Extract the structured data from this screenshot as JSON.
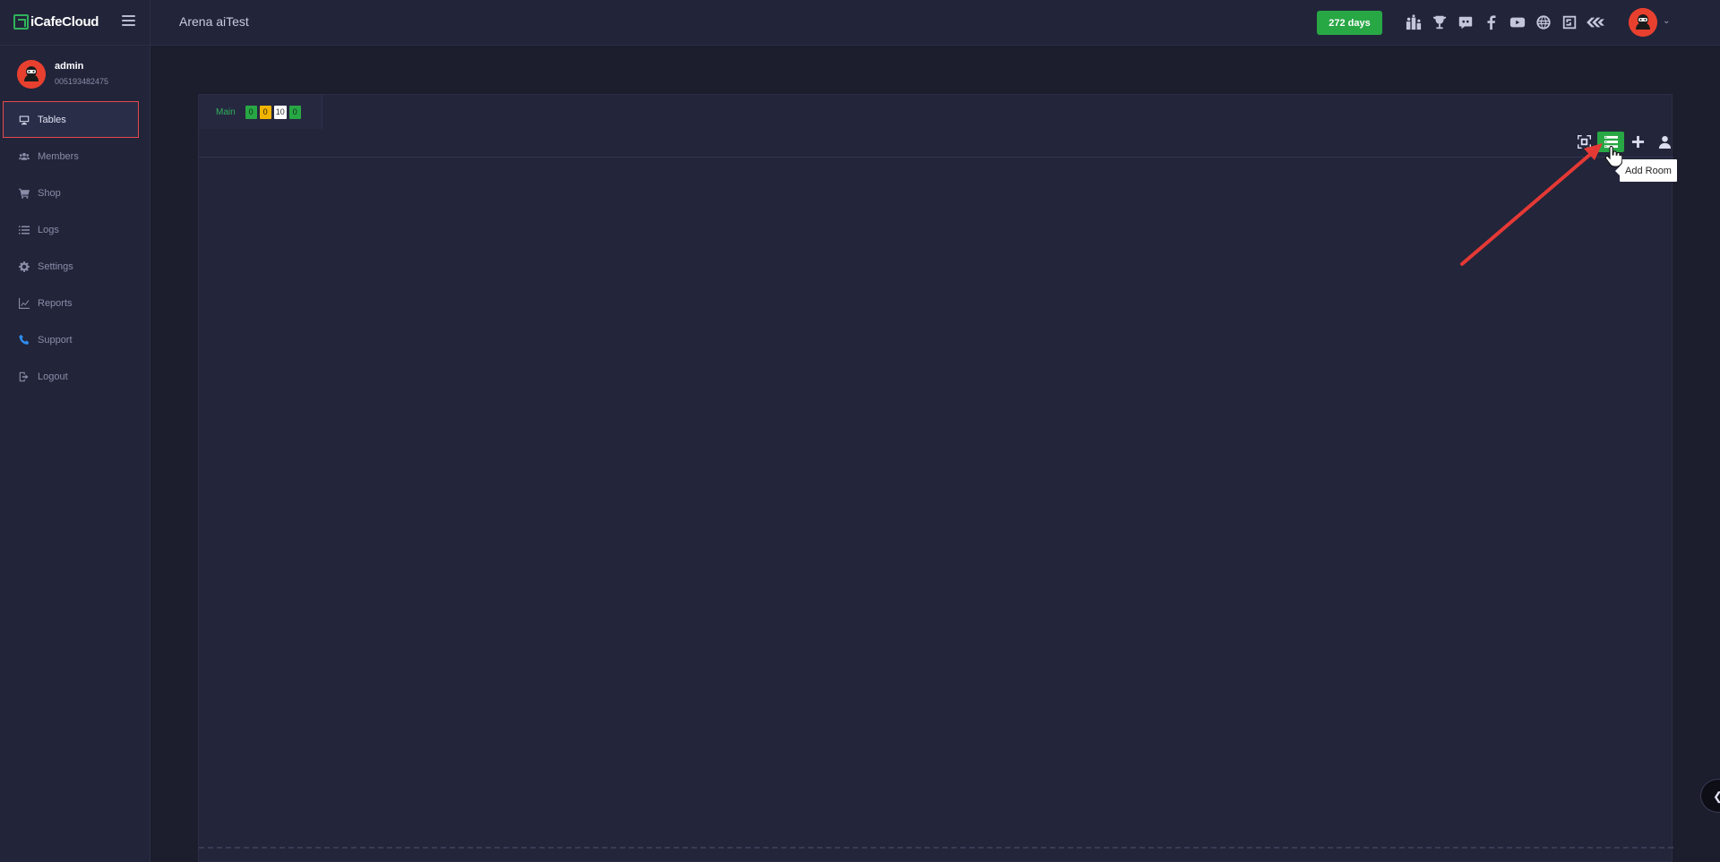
{
  "app": {
    "logo_text": "iCafeCloud",
    "title": "Arena aiTest"
  },
  "header": {
    "license_badge": "272 days",
    "icons": [
      "ranking-icon",
      "trophy-icon",
      "discord-icon",
      "facebook-icon",
      "youtube-icon",
      "globe-icon",
      "icafe-icon",
      "esports-icon"
    ]
  },
  "user": {
    "name": "admin",
    "id": "005193482475"
  },
  "sidebar": {
    "items": [
      {
        "label": "Tables",
        "icon": "monitor-icon",
        "active": true
      },
      {
        "label": "Members",
        "icon": "users-icon",
        "active": false
      },
      {
        "label": "Shop",
        "icon": "cart-icon",
        "active": false
      },
      {
        "label": "Logs",
        "icon": "list-icon",
        "active": false
      },
      {
        "label": "Settings",
        "icon": "gear-icon",
        "active": false
      },
      {
        "label": "Reports",
        "icon": "chart-line-icon",
        "active": false
      },
      {
        "label": "Support",
        "icon": "phone-icon",
        "active": false
      },
      {
        "label": "Logout",
        "icon": "logout-icon",
        "active": false
      }
    ]
  },
  "rooms": {
    "tabs": [
      {
        "label": "Main",
        "counts": [
          "0",
          "0",
          "10",
          "0"
        ]
      }
    ]
  },
  "toolbar": {
    "tools": [
      "frame-icon",
      "room-list-icon",
      "plus-icon",
      "user-icon"
    ],
    "active_tool": "room-list-icon",
    "tooltip": "Add Room"
  },
  "colors": {
    "accent_green": "#28a745",
    "highlight_red": "#e34b4b",
    "warning_yellow": "#f0b400",
    "background": "#1e1f30"
  }
}
